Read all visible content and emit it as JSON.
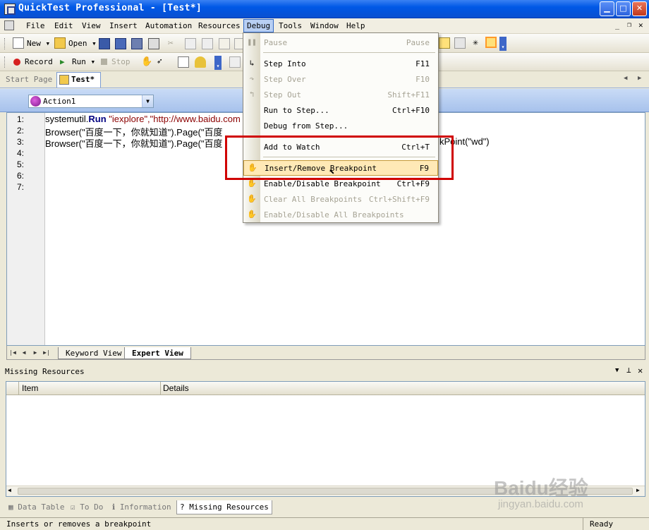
{
  "window": {
    "title": "QuickTest Professional - [Test*]"
  },
  "menubar": {
    "items": [
      "File",
      "Edit",
      "View",
      "Insert",
      "Automation",
      "Resources",
      "Debug",
      "Tools",
      "Window",
      "Help"
    ],
    "active": "Debug"
  },
  "toolbar1": {
    "new_label": "New",
    "open_label": "Open"
  },
  "toolbar2": {
    "record_label": "Record",
    "run_label": "Run",
    "stop_label": "Stop"
  },
  "doc_tabs": {
    "start_page": "Start Page",
    "test": "Test*"
  },
  "action_selector": {
    "value": "Action1"
  },
  "editor": {
    "line_numbers": [
      "1:",
      "2:",
      "3:",
      "4:",
      "5:",
      "6:",
      "7:"
    ],
    "lines": [
      {
        "p1": "systemutil.",
        "kw": "Run",
        "p2": " \"iexplore\",\"http://www.baidu.com"
      },
      {
        "p1": "Browser(\"百度一下，你就知道\").Page(\"百度",
        "kw": "",
        "p2": ""
      },
      {
        "p1": "Browser(\"百度一下，你就知道\").Page(\"百度",
        "kw": "",
        "p2": "kPoint(\"wd\")"
      }
    ]
  },
  "view_tabs": {
    "keyword_view": "Keyword View",
    "expert_view": "Expert View"
  },
  "missing_resources": {
    "title": "Missing Resources",
    "columns": [
      "Item",
      "Details"
    ]
  },
  "bottom_tabs": [
    "Data Table",
    "To Do",
    "Information",
    "Missing Resources"
  ],
  "status": {
    "message": "Inserts or removes a breakpoint",
    "state": "Ready"
  },
  "debug_menu": {
    "items": [
      {
        "label": "Pause",
        "shortcut": "Pause",
        "enabled": false
      },
      {
        "label": "Step Into",
        "shortcut": "F11",
        "enabled": true
      },
      {
        "label": "Step Over",
        "shortcut": "F10",
        "enabled": false
      },
      {
        "label": "Step Out",
        "shortcut": "Shift+F11",
        "enabled": false
      },
      {
        "label": "Run to Step...",
        "shortcut": "Ctrl+F10",
        "enabled": true
      },
      {
        "label": "Debug from Step...",
        "shortcut": "",
        "enabled": true
      },
      {
        "label": "Add to Watch",
        "shortcut": "Ctrl+T",
        "enabled": true
      },
      {
        "label": "Insert/Remove Breakpoint",
        "shortcut": "F9",
        "enabled": true,
        "highlighted": true
      },
      {
        "label": "Enable/Disable Breakpoint",
        "shortcut": "Ctrl+F9",
        "enabled": true
      },
      {
        "label": "Clear All Breakpoints",
        "shortcut": "Ctrl+Shift+F9",
        "enabled": false
      },
      {
        "label": "Enable/Disable All Breakpoints",
        "shortcut": "",
        "enabled": false
      }
    ]
  },
  "watermark": {
    "logo": "Baidu经验",
    "url": "jingyan.baidu.com"
  },
  "colors": {
    "titlebar": "#0058e6",
    "highlight": "#ffe9b6",
    "annotation_box": "#d00000"
  }
}
